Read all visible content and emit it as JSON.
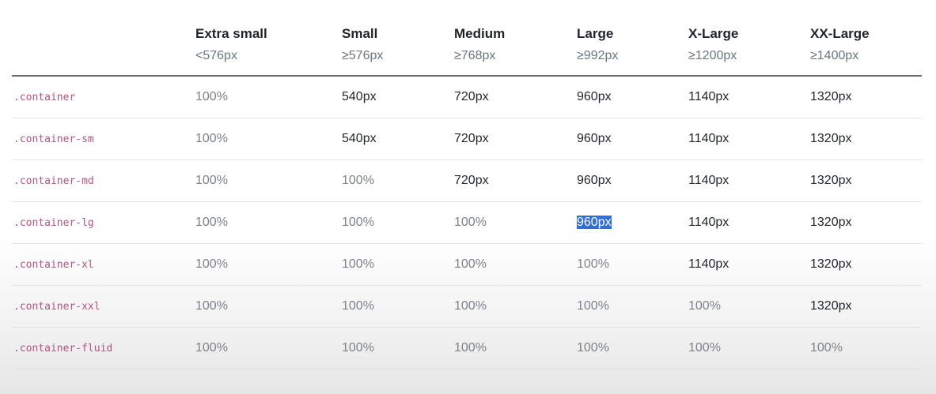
{
  "breakpoints": [
    {
      "name": "Extra small",
      "size": "<576px"
    },
    {
      "name": "Small",
      "size": "≥576px"
    },
    {
      "name": "Medium",
      "size": "≥768px"
    },
    {
      "name": "Large",
      "size": "≥992px"
    },
    {
      "name": "X-Large",
      "size": "≥1200px"
    },
    {
      "name": "XX-Large",
      "size": "≥1400px"
    }
  ],
  "rows": [
    {
      "class": ".container",
      "values": [
        "100%",
        "540px",
        "720px",
        "960px",
        "1140px",
        "1320px"
      ]
    },
    {
      "class": ".container-sm",
      "values": [
        "100%",
        "540px",
        "720px",
        "960px",
        "1140px",
        "1320px"
      ]
    },
    {
      "class": ".container-md",
      "values": [
        "100%",
        "100%",
        "720px",
        "960px",
        "1140px",
        "1320px"
      ]
    },
    {
      "class": ".container-lg",
      "values": [
        "100%",
        "100%",
        "100%",
        "960px",
        "1140px",
        "1320px"
      ]
    },
    {
      "class": ".container-xl",
      "values": [
        "100%",
        "100%",
        "100%",
        "100%",
        "1140px",
        "1320px"
      ]
    },
    {
      "class": ".container-xxl",
      "values": [
        "100%",
        "100%",
        "100%",
        "100%",
        "100%",
        "1320px"
      ]
    },
    {
      "class": ".container-fluid",
      "values": [
        "100%",
        "100%",
        "100%",
        "100%",
        "100%",
        "100%"
      ]
    }
  ],
  "selection": {
    "row": 3,
    "col": 3,
    "text": "960px",
    "highlight_color": "#2f6fd6"
  },
  "colors": {
    "class_name": "#b3557f",
    "percent_value": "#7d8288",
    "px_value": "#23272b"
  }
}
